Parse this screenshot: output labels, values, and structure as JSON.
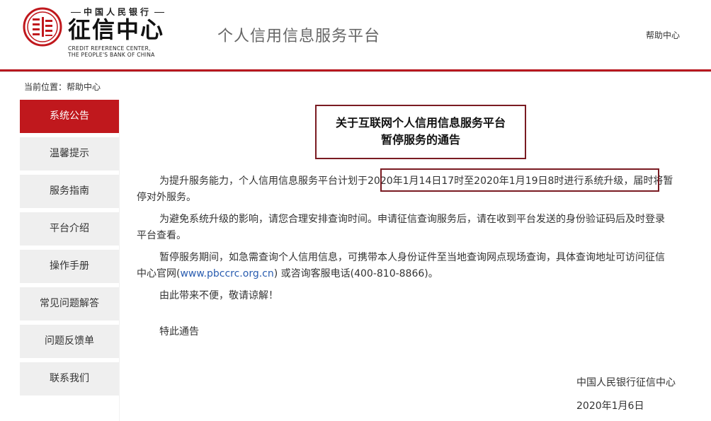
{
  "header": {
    "logo_bank": "中国人民银行",
    "logo_title": "征信中心",
    "logo_en_line1": "CREDIT REFERENCE CENTER,",
    "logo_en_line2": "THE PEOPLE'S BANK OF CHINA",
    "platform_title": "个人信用信息服务平台",
    "help_link": "帮助中心",
    "accent_color": "#b8171e"
  },
  "breadcrumb": "当前位置：帮助中心",
  "sidebar": {
    "items": [
      {
        "label": "系统公告",
        "active": true
      },
      {
        "label": "温馨提示"
      },
      {
        "label": "服务指南"
      },
      {
        "label": "平台介绍"
      },
      {
        "label": "操作手册"
      },
      {
        "label": "常见问题解答"
      },
      {
        "label": "问题反馈单"
      },
      {
        "label": "联系我们"
      }
    ]
  },
  "notice": {
    "title_line1": "关于互联网个人信用信息服务平台",
    "title_line2": "暂停服务的通告",
    "p1_a": "为提升服务能力，个人信用信息服务平台计划于",
    "p1_b": "2020年1月14日17时至2020年1月19日8时进行系统升级",
    "p1_c": "，届时将暂",
    "p1_d": "停对外服务。",
    "p2_a": "为避免系统升级的影响，请您合理安排查询时间。申请征信查询服务后，请在收到平台发送的身份验证码后及时登录",
    "p2_b": "平台查看。",
    "p3_a": "暂停服务期间，如急需查询个人信用信息，可携带本人身份证件至当地查询网点现场查询，具体查询地址可访问征信",
    "p3_b": "中心官网(",
    "p3_link": "www.pbccrc.org.cn",
    "p3_c": ") 或咨询客服电话(400-810-8866)。",
    "p4": "由此带来不便，敬请谅解！",
    "p5": "特此通告",
    "sign_org": "中国人民银行征信中心",
    "sign_date": "2020年1月6日"
  }
}
